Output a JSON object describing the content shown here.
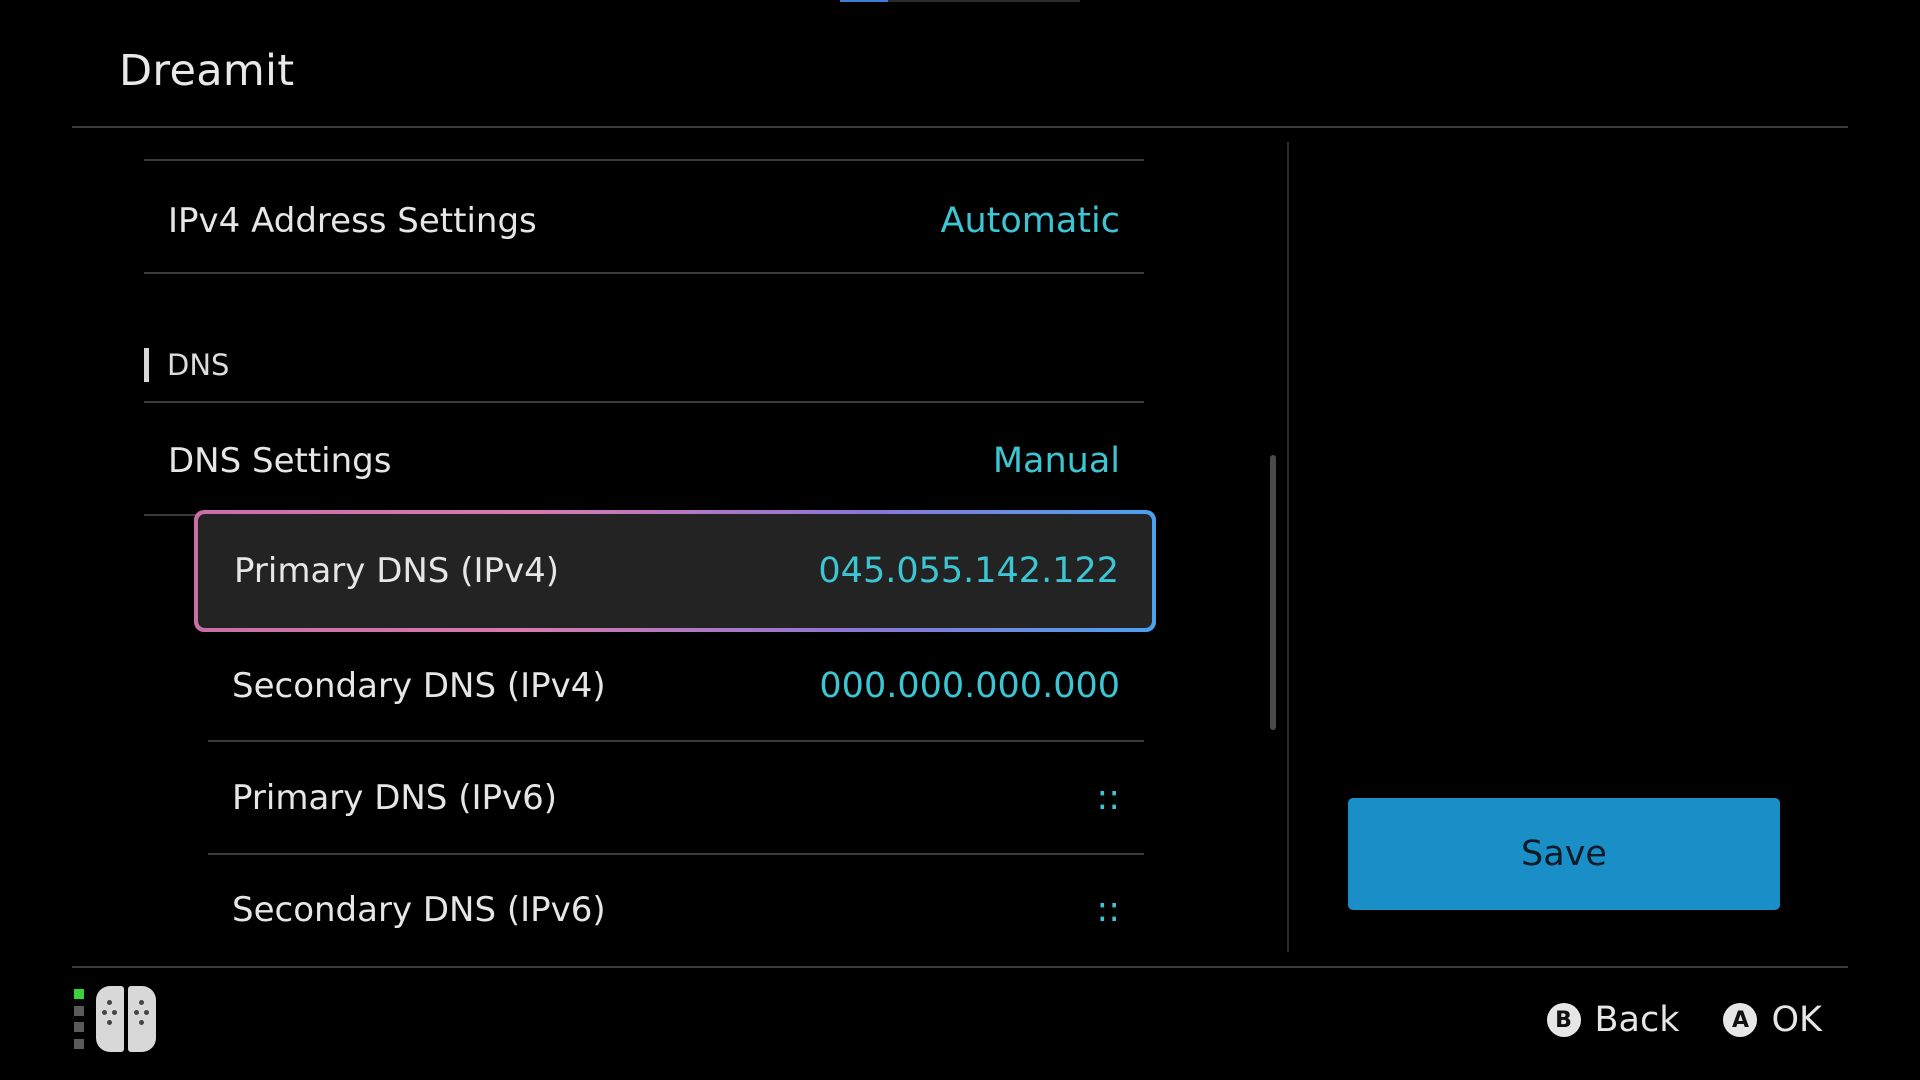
{
  "header": {
    "title": "Dreamit"
  },
  "rows": {
    "ipv4_address": {
      "label": "IPv4 Address Settings",
      "value": "Automatic"
    },
    "dns_settings": {
      "label": "DNS Settings",
      "value": "Manual"
    },
    "primary_dns_ipv4": {
      "label": "Primary DNS (IPv4)",
      "value": "045.055.142.122"
    },
    "secondary_dns_ipv4": {
      "label": "Secondary DNS (IPv4)",
      "value": "000.000.000.000"
    },
    "primary_dns_ipv6": {
      "label": "Primary DNS (IPv6)",
      "value": "::"
    },
    "secondary_dns_ipv6": {
      "label": "Secondary DNS (IPv6)",
      "value": "::"
    }
  },
  "sections": {
    "dns_header": "DNS"
  },
  "actions": {
    "save_label": "Save"
  },
  "footer": {
    "back_button_glyph": "B",
    "back_label": "Back",
    "ok_button_glyph": "A",
    "ok_label": "OK"
  },
  "colors": {
    "background": "#000000",
    "value_accent": "#3cc6d4",
    "save_button": "#1a8fc7",
    "selection_gradient_start": "#c96fa8",
    "selection_gradient_end": "#4aa2ef",
    "battery_on": "#3bd13b"
  },
  "icons": {
    "controller": "joycon-pair-icon",
    "battery": "battery-level-icon",
    "back": "b-button-icon",
    "ok": "a-button-icon"
  }
}
